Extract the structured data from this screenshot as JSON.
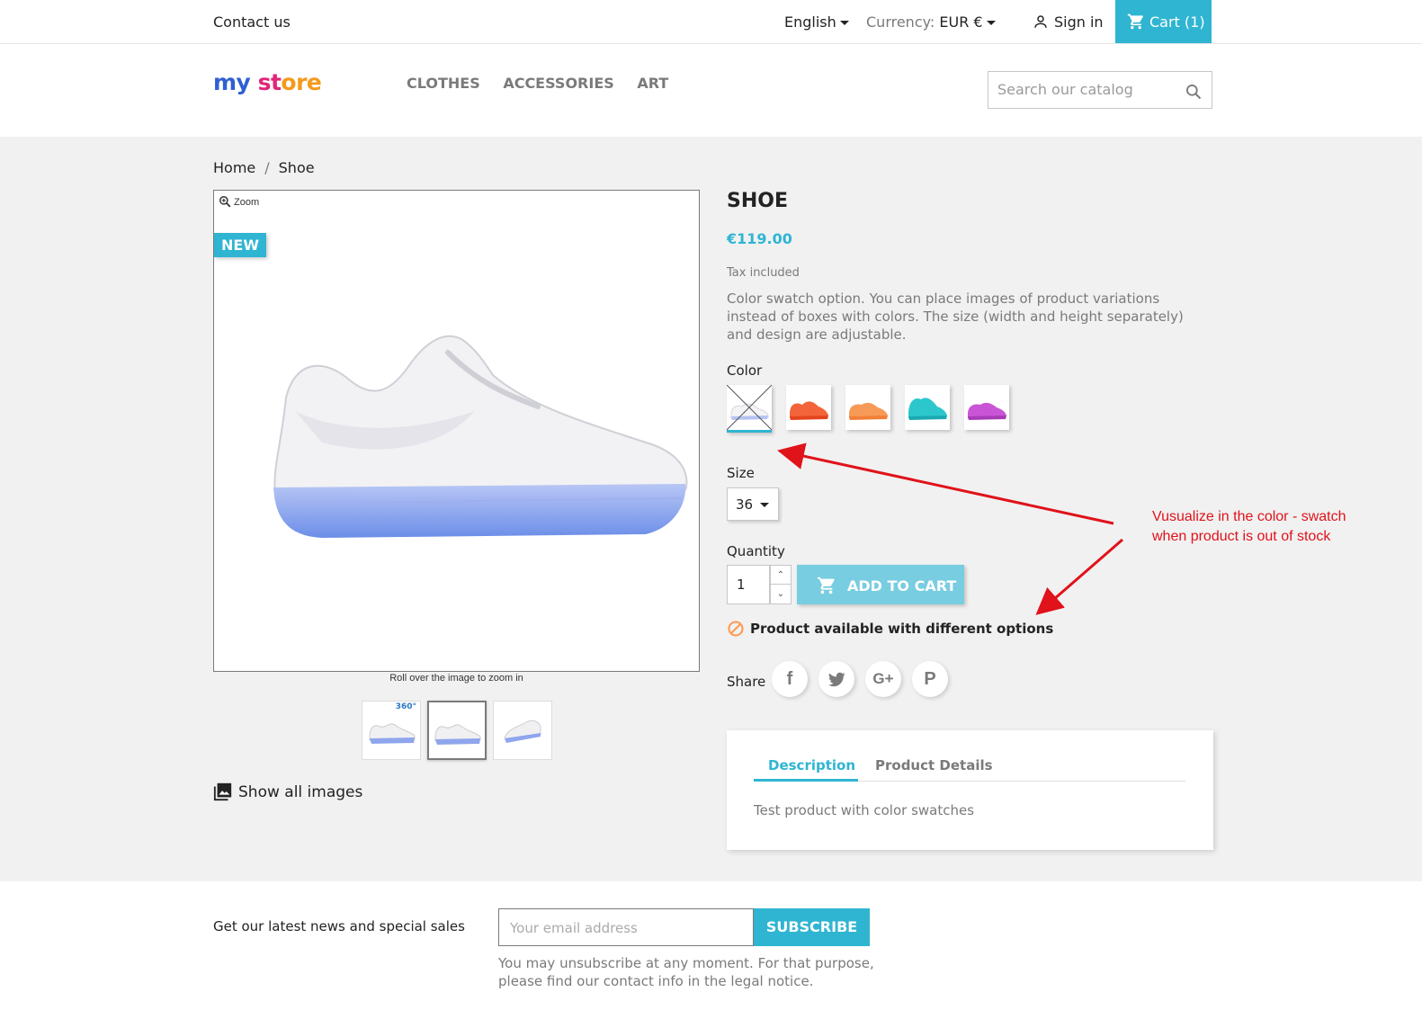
{
  "topbar": {
    "contact": "Contact us",
    "language": "English",
    "currency_label": "Currency:",
    "currency_value": "EUR €",
    "signin": "Sign in",
    "cart": "Cart (1)"
  },
  "header": {
    "logo": [
      "my",
      " ",
      "st",
      "ore"
    ],
    "menu": [
      "CLOTHES",
      "ACCESSORIES",
      "ART"
    ],
    "search_placeholder": "Search our catalog"
  },
  "breadcrumb": [
    "Home",
    "Shoe"
  ],
  "gallery": {
    "zoom_label": "Zoom",
    "badge": "NEW",
    "rollover_hint": "Roll over the image to zoom in",
    "thumb_badge": "360°",
    "show_all": "Show all images"
  },
  "product": {
    "title": "SHOE",
    "price": "€119.00",
    "tax": "Tax included",
    "description": "Color swatch option. You can place images of product variations instead of boxes with colors. The size (width and height separately) and design are adjustable.",
    "color_label": "Color",
    "swatch_colors": [
      "#f4f4f6",
      "#f3643a",
      "#f79a58",
      "#2cc7cc",
      "#c955d6"
    ],
    "size_label": "Size",
    "size_value": "36",
    "quantity_label": "Quantity",
    "quantity_value": "1",
    "add_to_cart": "ADD TO CART",
    "availability": "Product available with different options",
    "share_label": "Share",
    "social": [
      "f",
      "t",
      "G+",
      "P"
    ]
  },
  "tabs": {
    "description_tab": "Description",
    "details_tab": "Product Details",
    "content": "Test product with color swatches"
  },
  "annotation": {
    "line1": "Vusualize in the color - swatch",
    "line2": "when product is out of stock"
  },
  "newsletter": {
    "text": "Get our latest news and special sales",
    "placeholder": "Your email address",
    "button": "SUBSCRIBE",
    "note": "You may unsubscribe at any moment. For that purpose, please find our contact info in the legal notice."
  },
  "colors": {
    "accent": "#2fb5d2",
    "annotation": "#e0121a"
  }
}
